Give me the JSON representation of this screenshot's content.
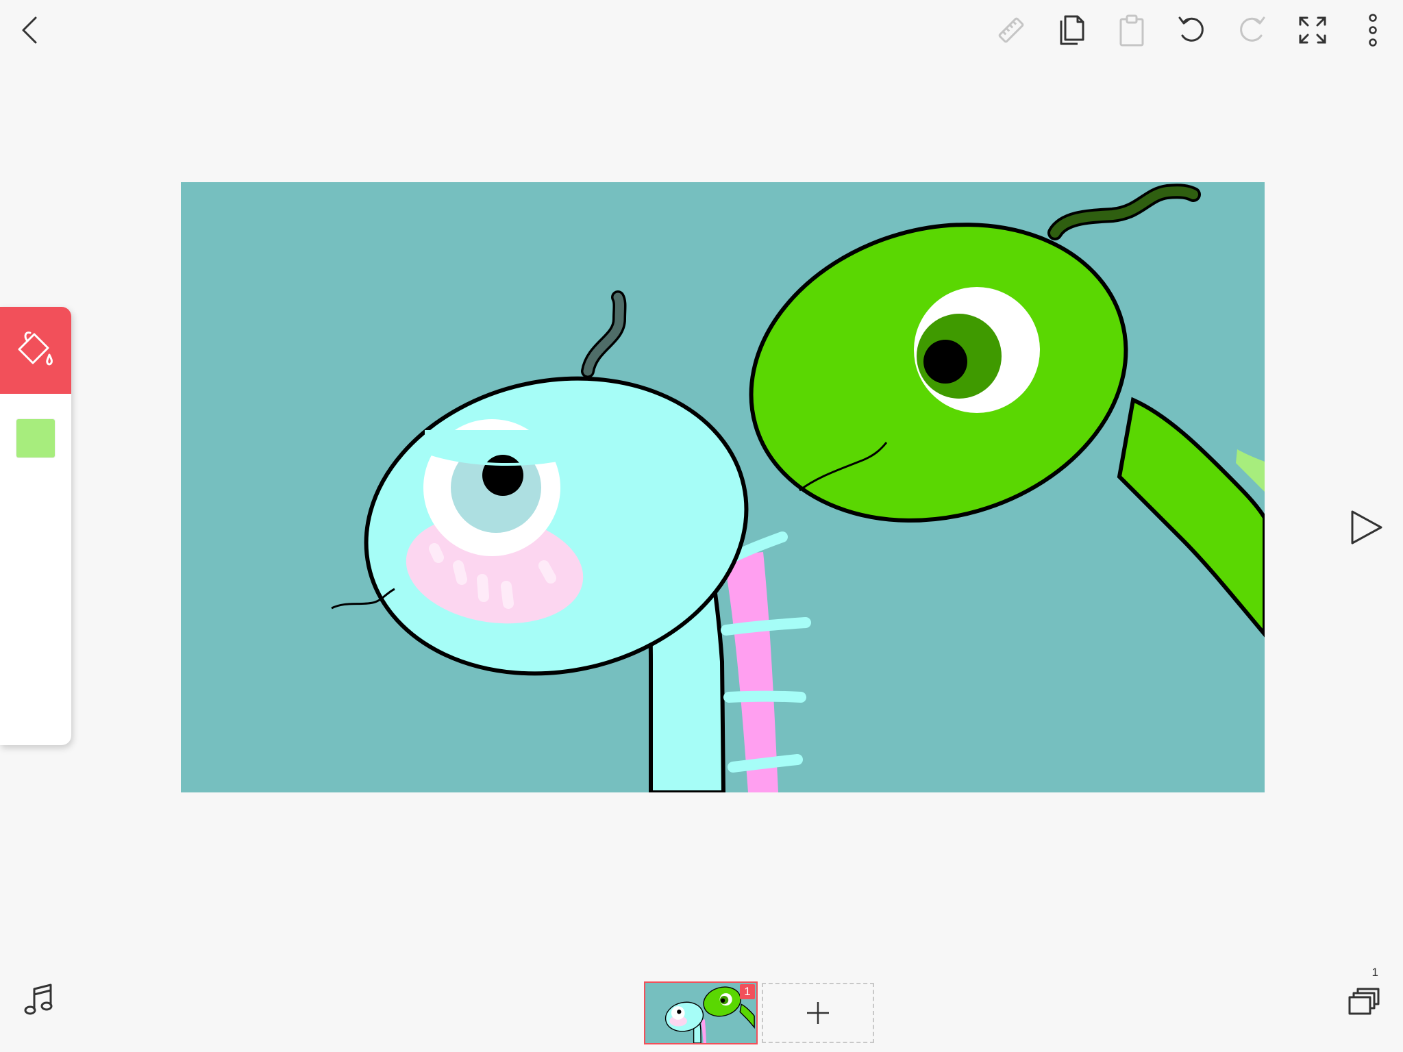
{
  "toolbar": {
    "back_icon": "chevron-left-icon",
    "ruler_icon": "ruler-icon",
    "copy_icon": "copy-icon",
    "paste_icon": "clipboard-icon",
    "undo_icon": "undo-icon",
    "redo_icon": "redo-icon",
    "fullscreen_icon": "expand-icon",
    "more_icon": "more-vertical-icon"
  },
  "tools": {
    "active_tool": "fill-bucket-icon",
    "accent_color": "#f2505a",
    "current_color": "#a7ed7d"
  },
  "canvas": {
    "background_color": "#76bfbf"
  },
  "timeline": {
    "frames": [
      {
        "badge": "1",
        "selected": true
      }
    ],
    "add_frame_icon": "plus-icon"
  },
  "bottom": {
    "music_icon": "music-note-icon",
    "layers_icon": "layers-icon",
    "layer_count": "1"
  },
  "play_icon": "play-icon"
}
